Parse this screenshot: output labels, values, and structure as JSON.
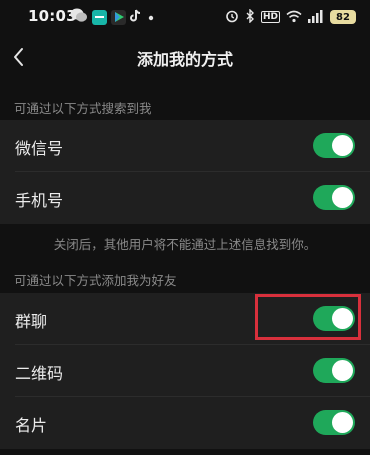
{
  "status_bar": {
    "time": "10:03",
    "battery": "82",
    "network_label": "HD",
    "icons": [
      "wechat-icon",
      "app-icon",
      "play-store-icon",
      "tiktok-icon",
      "dot-icon",
      "alarm-icon",
      "bluetooth-icon",
      "hd-icon",
      "wifi-icon",
      "signal-icon",
      "battery-icon"
    ]
  },
  "nav": {
    "title": "添加我的方式",
    "back_icon": "chevron-left-icon"
  },
  "search_section": {
    "header": "可通过以下方式搜索到我",
    "items": [
      {
        "label": "微信号",
        "enabled": true
      },
      {
        "label": "手机号",
        "enabled": true
      }
    ],
    "footnote": "关闭后，其他用户将不能通过上述信息找到你。"
  },
  "add_section": {
    "header": "可通过以下方式添加我为好友",
    "items": [
      {
        "label": "群聊",
        "enabled": true
      },
      {
        "label": "二维码",
        "enabled": true
      },
      {
        "label": "名片",
        "enabled": true
      }
    ]
  },
  "colors": {
    "background": "#111111",
    "row_background": "#1f1f1f",
    "toggle_on": "#1fa85a",
    "highlight": "#d8303c"
  }
}
